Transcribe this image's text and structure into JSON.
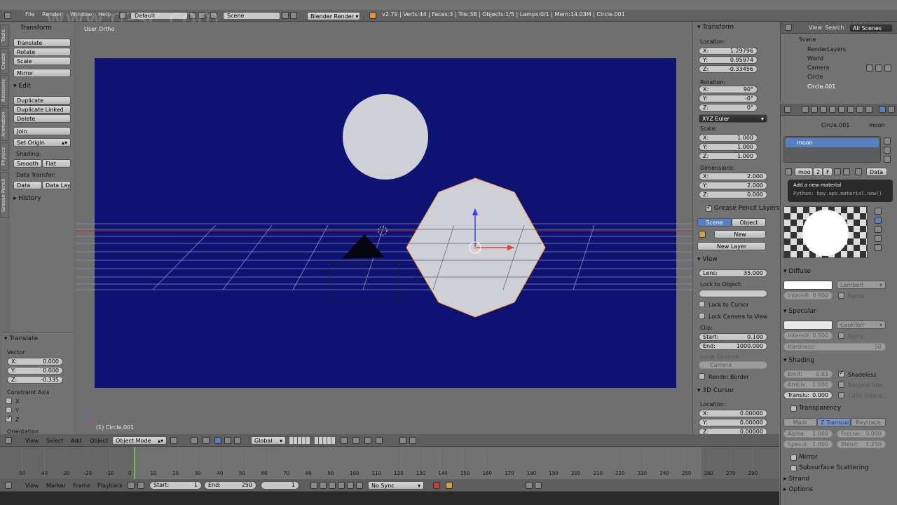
{
  "topbar": {
    "menus": [
      "File",
      "Render",
      "Window",
      "Help"
    ],
    "layout": "Default",
    "scene": "Scene",
    "engine": "Blender Render",
    "stats": "v2.79 | Verts:44 | Faces:3 | Tris:38 | Objects:1/5 | Lamps:0/1 | Mem:14.03M | Circle.001"
  },
  "watermark": "www.rr-sc.com",
  "toolshelf": {
    "tabs": [
      "Tools",
      "Create",
      "Relations",
      "Animation",
      "Physics",
      "Grease Pencil"
    ],
    "transform_header": "Transform",
    "transform_buttons": [
      "Translate",
      "Rotate",
      "Scale",
      "Mirror"
    ],
    "edit_header": "Edit",
    "edit_buttons": [
      "Duplicate",
      "Duplicate Linked",
      "Delete",
      "Join"
    ],
    "set_origin": "Set Origin",
    "shading_label": "Shading:",
    "smooth": "Smooth",
    "flat": "Flat",
    "data_transfer_label": "Data Transfer:",
    "data": "Data",
    "data_lay": "Data Lay",
    "history": "History",
    "operator_header": "Translate",
    "vector_label": "Vector",
    "vector": [
      {
        "k": "X:",
        "v": "0.000"
      },
      {
        "k": "Y:",
        "v": "0.000"
      },
      {
        "k": "Z:",
        "v": "-0.335"
      }
    ],
    "constraint_label": "Constraint Axis",
    "constraints": [
      {
        "k": "X",
        "on": false
      },
      {
        "k": "Y",
        "on": false
      },
      {
        "k": "Z",
        "on": true
      }
    ],
    "orientation_label": "Orientation"
  },
  "viewport": {
    "view_name": "User Ortho",
    "object_label": "(1) Circle.001",
    "bg": "#0d1273",
    "moon_color": "#cfcfd6"
  },
  "properties_panel": {
    "transform_header": "Transform",
    "location_label": "Location:",
    "location": [
      {
        "k": "X:",
        "v": "1.29796"
      },
      {
        "k": "Y:",
        "v": "0.95974"
      },
      {
        "k": "Z:",
        "v": "-0.33456"
      }
    ],
    "rotation_label": "Rotation:",
    "rotation": [
      {
        "k": "X:",
        "v": "90°"
      },
      {
        "k": "Y:",
        "v": "-0°"
      },
      {
        "k": "Z:",
        "v": "0°"
      }
    ],
    "rotation_mode": "XYZ Euler",
    "scale_label": "Scale:",
    "scale": [
      {
        "k": "X:",
        "v": "1.000"
      },
      {
        "k": "Y:",
        "v": "1.000"
      },
      {
        "k": "Z:",
        "v": "1.000"
      }
    ],
    "dimensions_label": "Dimensions:",
    "dimensions": [
      {
        "k": "X:",
        "v": "2.000"
      },
      {
        "k": "Y:",
        "v": "2.000"
      },
      {
        "k": "Z:",
        "v": "0.000"
      }
    ],
    "gp_header": "Grease Pencil Layers",
    "gp_scene": "Scene",
    "gp_object": "Object",
    "gp_new": "New",
    "gp_new_layer": "New Layer",
    "view_header": "View",
    "lens": {
      "k": "Lens:",
      "v": "35.000"
    },
    "lock_to_object": "Lock to Object:",
    "lock_to_cursor": "Lock to Cursor",
    "lock_camera": "Lock Camera to View",
    "clip_label": "Clip:",
    "clip_start": {
      "k": "Start:",
      "v": "0.100"
    },
    "clip_end": {
      "k": "End:",
      "v": "1000.000"
    },
    "local_camera": "Local Camera:",
    "camera": "Camera",
    "render_border": "Render Border",
    "cursor_header": "3D Cursor",
    "cursor_location": "Location:",
    "cursor": [
      {
        "k": "X:",
        "v": "0.00000"
      },
      {
        "k": "Y:",
        "v": "0.00000"
      },
      {
        "k": "Z:",
        "v": "0.00000"
      }
    ]
  },
  "outliner": {
    "menus": [
      "View",
      "Search"
    ],
    "all_scenes": "All Scenes",
    "items": [
      "Scene",
      "RenderLayers",
      "World",
      "Camera",
      "Circle",
      "Circle.001"
    ]
  },
  "material": {
    "breadcrumb_object": "Circle.001",
    "breadcrumb_material": "moon",
    "slot_name": "moon",
    "mat_name": "moo",
    "users": "2",
    "fake": "F",
    "data": "Data",
    "tooltip_title": "Add a new material",
    "tooltip_python": "Python: bpy.ops.material.new()",
    "diffuse_header": "Diffuse",
    "diffuse_shader": "Lambert",
    "diffuse_intensity": "Intensit: 0.800",
    "ramp": "Ramp",
    "specular_header": "Specular",
    "specular_shader": "CookTorr",
    "specular_intensity": "Intensit: 0.500",
    "hardness": {
      "k": "Hardness:",
      "v": "50"
    },
    "shading_header": "Shading",
    "emit": {
      "k": "Emit:",
      "v": "0.63"
    },
    "ambient": {
      "k": "Ambie:",
      "v": "1.000"
    },
    "translucency": {
      "k": "Translu:",
      "v": "0.000"
    },
    "shadeless": "Shadeless",
    "tangent": "Tangent Sha...",
    "cubic": "Cubic Interp...",
    "transparency_header": "Transparency",
    "mask": "Mask",
    "ztransp": "Z Transpar...",
    "raytrace": "Raytrace",
    "alpha": {
      "k": "Alpha:",
      "v": "1.000"
    },
    "fresnel": {
      "k": "Fresne:",
      "v": "0.000"
    },
    "specular_alpha": {
      "k": "Specul:",
      "v": "1.000"
    },
    "blend": {
      "k": "Blend:",
      "v": "1.250"
    },
    "mirror": "Mirror",
    "sss": "Subsurface Scattering",
    "strand": "Strand",
    "options": "Options"
  },
  "view3d_header": {
    "menus": [
      "View",
      "Select",
      "Add",
      "Object"
    ],
    "mode": "Object Mode",
    "orientation": "Global"
  },
  "timeline": {
    "ticks": [
      "-50",
      "-40",
      "-30",
      "-20",
      "-10",
      "0",
      "10",
      "20",
      "30",
      "40",
      "50",
      "60",
      "70",
      "80",
      "90",
      "100",
      "110",
      "120",
      "130",
      "140",
      "150",
      "160",
      "170",
      "180",
      "190",
      "200",
      "210",
      "220",
      "230",
      "240",
      "250",
      "260",
      "270",
      "280"
    ],
    "menus": [
      "View",
      "Marker",
      "Frame",
      "Playback"
    ],
    "start": {
      "k": "Start:",
      "v": "1"
    },
    "end": {
      "k": "End:",
      "v": "250"
    },
    "current": "1",
    "sync": "No Sync"
  }
}
